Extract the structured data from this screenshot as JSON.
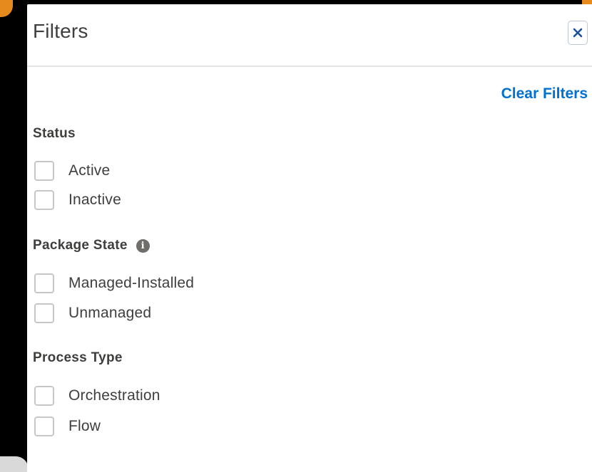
{
  "panel": {
    "title": "Filters",
    "close_icon": "close-x-icon",
    "clear_label": "Clear Filters"
  },
  "sections": [
    {
      "title": "Status",
      "options": [
        "Active",
        "Inactive"
      ]
    },
    {
      "title": "Package State",
      "info_icon": "info-icon",
      "info_glyph": "i",
      "options": [
        "Managed-Installed",
        "Unmanaged"
      ]
    },
    {
      "title": "Process Type",
      "options": [
        "Orchestration",
        "Flow"
      ]
    }
  ],
  "colors": {
    "link": "#0070d2",
    "text": "#3e3e3c",
    "accent_corner": "#e68a1e"
  }
}
